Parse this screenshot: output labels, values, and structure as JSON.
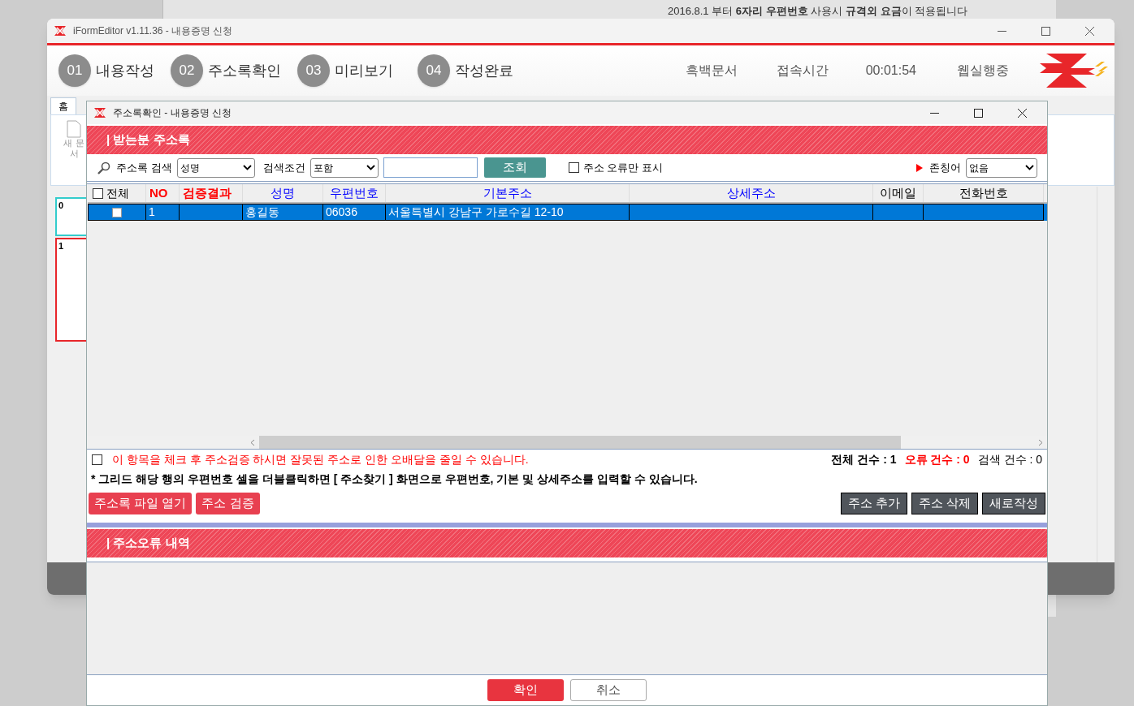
{
  "background_notice": "2016.8.1 부터 **6자리 우편번호** 사용시 **규격외 요금**이 적용됩니다",
  "main_window": {
    "title": "iFormEditor v1.11.36 - 내용증명 신청",
    "steps": [
      {
        "number": "01",
        "label": "내용작성"
      },
      {
        "number": "02",
        "label": "주소록확인"
      },
      {
        "number": "03",
        "label": "미리보기"
      },
      {
        "number": "04",
        "label": "작성완료"
      }
    ],
    "status": [
      "흑백문서",
      "접속시간",
      "00:01:54",
      "웹실행중"
    ],
    "tab": "홈",
    "ribbon_button": "새 문서",
    "thumbnails": [
      {
        "label": "0",
        "selected": false
      },
      {
        "label": "1",
        "selected": true
      }
    ]
  },
  "dialog": {
    "title": "주소록확인 - 내용증명 신청",
    "section_title": "| 받는분 주소록",
    "search": {
      "label": "주소록 검색",
      "field": "성명",
      "condition_label": "검색조건",
      "condition": "포함",
      "button": "조회",
      "error_only": {
        "label": "주소 오류만 표시",
        "checked": false
      },
      "honorific_label": "존칭어",
      "honorific": "없음"
    },
    "table": {
      "select_all": {
        "label": "전체",
        "checked": false
      },
      "columns": [
        {
          "label": "NO",
          "color": "#ff0000"
        },
        {
          "label": "검증결과",
          "color": "#ff0000"
        },
        {
          "label": "성명",
          "color": "#0000ff"
        },
        {
          "label": "우편번호",
          "color": "#0000ff"
        },
        {
          "label": "기본주소",
          "color": "#0000ff"
        },
        {
          "label": "상세주소",
          "color": "#0000ff"
        },
        {
          "label": "이메일",
          "color": "#000000"
        },
        {
          "label": "전화번호",
          "color": "#000000"
        }
      ],
      "rows": [
        {
          "selected": true,
          "checked": false,
          "cells": [
            "1",
            "",
            "홍길동",
            "06036",
            "서울특별시 강남구 가로수길 12-10",
            "",
            "",
            ""
          ]
        }
      ]
    },
    "verify_notice": {
      "label": "이 항목을 체크 후 주소검증 하시면 잘못된 주소로 인한 오배달을 줄일 수 있습니다.",
      "checked": false
    },
    "counts": {
      "total": "전체 건수 : 1",
      "errors": "오류 건수 : 0",
      "search": "검색 건수 : 0"
    },
    "help": "* 그리드 해당 행의 우편번호 셀을 더블클릭하면 [ 주소찾기 ] 화면으로 우편번호, 기본 및 상세주소를 입력할 수 있습니다.",
    "left_buttons": [
      "주소록 파일 열기",
      "주소 검증"
    ],
    "right_buttons": [
      "주소 추가",
      "주소 삭제",
      "새로작성"
    ],
    "error_section_title": "| 주소오류 내역",
    "footer_buttons": [
      {
        "label": "확인",
        "kind": "primary"
      },
      {
        "label": "취소",
        "kind": "secondary"
      }
    ]
  }
}
